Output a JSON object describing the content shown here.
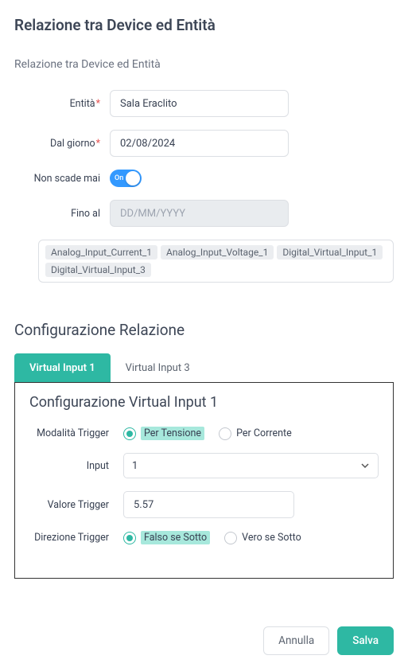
{
  "page": {
    "title": "Relazione tra Device ed Entità",
    "subtitle": "Relazione tra Device ed Entità"
  },
  "form": {
    "entity_label": "Entità",
    "entity_value": "Sala Eraclito",
    "from_label": "Dal giorno",
    "from_value": "02/08/2024",
    "never_expires_label": "Non scade mai",
    "toggle_on_text": "On",
    "until_label": "Fino al",
    "until_placeholder": "DD/MM/YYYY",
    "tags": [
      "Analog_Input_Current_1",
      "Analog_Input_Voltage_1",
      "Digital_Virtual_Input_1",
      "Digital_Virtual_Input_3"
    ]
  },
  "config": {
    "section_title": "Configurazione Relazione",
    "tabs": [
      {
        "label": "Virtual Input 1",
        "active": true
      },
      {
        "label": "Virtual Input 3",
        "active": false
      }
    ],
    "panel_title": "Configurazione Virtual Input 1",
    "trigger_mode_label": "Modalità Trigger",
    "mode_voltage": "Per Tensione",
    "mode_current": "Per Corrente",
    "input_label": "Input",
    "input_value": "1",
    "trigger_value_label": "Valore Trigger",
    "trigger_value": "5.57",
    "direction_label": "Direzione Trigger",
    "dir_false_below": "Falso se Sotto",
    "dir_true_below": "Vero se Sotto"
  },
  "footer": {
    "cancel": "Annulla",
    "save": "Salva"
  }
}
